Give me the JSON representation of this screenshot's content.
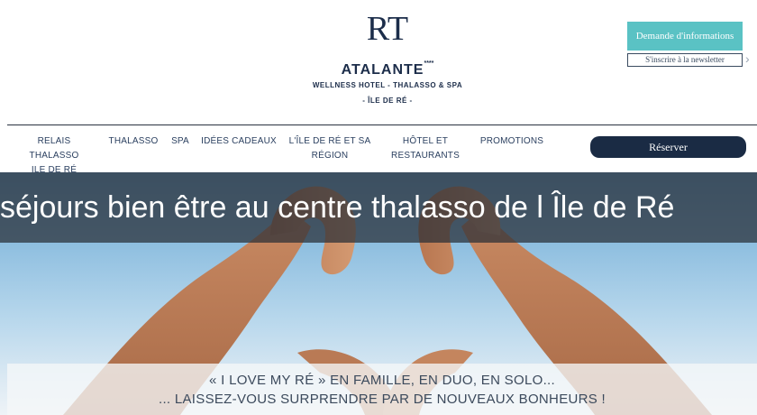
{
  "brand": {
    "monogram": "RT",
    "name": "ATALANTE",
    "stars": "****",
    "subtitle": "WELLNESS HOTEL - THALASSO & SPA",
    "location": "- ÎLE DE RÉ -"
  },
  "header": {
    "info_button": "Demande d'informations",
    "newsletter": "S'inscrire à la newsletter"
  },
  "nav": {
    "items": [
      {
        "line1": "RELAIS THALASSO",
        "line2": "ILE DE RÉ"
      },
      {
        "line1": "THALASSO",
        "line2": ""
      },
      {
        "line1": "SPA",
        "line2": ""
      },
      {
        "line1": "IDÉES CADEAUX",
        "line2": ""
      },
      {
        "line1": "L'ÎLE DE RÉ ET SA",
        "line2": "RÉGION"
      },
      {
        "line1": "HÔTEL ET",
        "line2": "RESTAURANTS"
      },
      {
        "line1": "PROMOTIONS",
        "line2": ""
      }
    ],
    "reserve": "Réserver"
  },
  "hero": {
    "headline": "séjours bien être au centre thalasso de l Île de Ré",
    "tagline_1": "« I LOVE MY RÉ » EN FAMILLE, EN DUO, EN SOLO...",
    "tagline_2": "... LAISSEZ-VOUS SURPRENDRE PAR DE NOUVEAUX BONHEURS !"
  },
  "colors": {
    "navy": "#1a2b44",
    "teal": "#5ac2c4",
    "sky": "#8fbfe0"
  }
}
